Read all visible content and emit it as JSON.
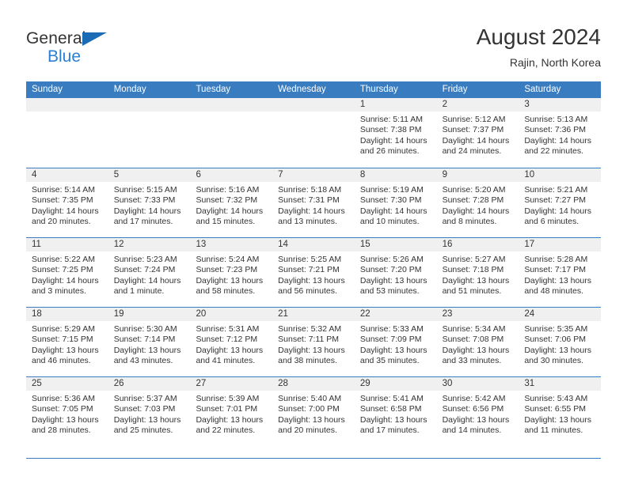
{
  "brand": {
    "line1": "General",
    "line2": "Blue",
    "logo_icon": "blue-triangle-logo-icon"
  },
  "header": {
    "title": "August 2024",
    "subtitle": "Rajin, North Korea"
  },
  "colors": {
    "header_blue": "#3a7cc0",
    "brand_blue": "#2a7fd4",
    "logo_blue": "#1b6cb5",
    "day_number_bg": "#f0f0f0",
    "text": "#333333"
  },
  "calendar": {
    "weekdays": [
      "Sunday",
      "Monday",
      "Tuesday",
      "Wednesday",
      "Thursday",
      "Friday",
      "Saturday"
    ],
    "weeks": [
      [
        {
          "day": "",
          "sunrise": "",
          "sunset": "",
          "daylight1": "",
          "daylight2": ""
        },
        {
          "day": "",
          "sunrise": "",
          "sunset": "",
          "daylight1": "",
          "daylight2": ""
        },
        {
          "day": "",
          "sunrise": "",
          "sunset": "",
          "daylight1": "",
          "daylight2": ""
        },
        {
          "day": "",
          "sunrise": "",
          "sunset": "",
          "daylight1": "",
          "daylight2": ""
        },
        {
          "day": "1",
          "sunrise": "Sunrise: 5:11 AM",
          "sunset": "Sunset: 7:38 PM",
          "daylight1": "Daylight: 14 hours",
          "daylight2": "and 26 minutes."
        },
        {
          "day": "2",
          "sunrise": "Sunrise: 5:12 AM",
          "sunset": "Sunset: 7:37 PM",
          "daylight1": "Daylight: 14 hours",
          "daylight2": "and 24 minutes."
        },
        {
          "day": "3",
          "sunrise": "Sunrise: 5:13 AM",
          "sunset": "Sunset: 7:36 PM",
          "daylight1": "Daylight: 14 hours",
          "daylight2": "and 22 minutes."
        }
      ],
      [
        {
          "day": "4",
          "sunrise": "Sunrise: 5:14 AM",
          "sunset": "Sunset: 7:35 PM",
          "daylight1": "Daylight: 14 hours",
          "daylight2": "and 20 minutes."
        },
        {
          "day": "5",
          "sunrise": "Sunrise: 5:15 AM",
          "sunset": "Sunset: 7:33 PM",
          "daylight1": "Daylight: 14 hours",
          "daylight2": "and 17 minutes."
        },
        {
          "day": "6",
          "sunrise": "Sunrise: 5:16 AM",
          "sunset": "Sunset: 7:32 PM",
          "daylight1": "Daylight: 14 hours",
          "daylight2": "and 15 minutes."
        },
        {
          "day": "7",
          "sunrise": "Sunrise: 5:18 AM",
          "sunset": "Sunset: 7:31 PM",
          "daylight1": "Daylight: 14 hours",
          "daylight2": "and 13 minutes."
        },
        {
          "day": "8",
          "sunrise": "Sunrise: 5:19 AM",
          "sunset": "Sunset: 7:30 PM",
          "daylight1": "Daylight: 14 hours",
          "daylight2": "and 10 minutes."
        },
        {
          "day": "9",
          "sunrise": "Sunrise: 5:20 AM",
          "sunset": "Sunset: 7:28 PM",
          "daylight1": "Daylight: 14 hours",
          "daylight2": "and 8 minutes."
        },
        {
          "day": "10",
          "sunrise": "Sunrise: 5:21 AM",
          "sunset": "Sunset: 7:27 PM",
          "daylight1": "Daylight: 14 hours",
          "daylight2": "and 6 minutes."
        }
      ],
      [
        {
          "day": "11",
          "sunrise": "Sunrise: 5:22 AM",
          "sunset": "Sunset: 7:25 PM",
          "daylight1": "Daylight: 14 hours",
          "daylight2": "and 3 minutes."
        },
        {
          "day": "12",
          "sunrise": "Sunrise: 5:23 AM",
          "sunset": "Sunset: 7:24 PM",
          "daylight1": "Daylight: 14 hours",
          "daylight2": "and 1 minute."
        },
        {
          "day": "13",
          "sunrise": "Sunrise: 5:24 AM",
          "sunset": "Sunset: 7:23 PM",
          "daylight1": "Daylight: 13 hours",
          "daylight2": "and 58 minutes."
        },
        {
          "day": "14",
          "sunrise": "Sunrise: 5:25 AM",
          "sunset": "Sunset: 7:21 PM",
          "daylight1": "Daylight: 13 hours",
          "daylight2": "and 56 minutes."
        },
        {
          "day": "15",
          "sunrise": "Sunrise: 5:26 AM",
          "sunset": "Sunset: 7:20 PM",
          "daylight1": "Daylight: 13 hours",
          "daylight2": "and 53 minutes."
        },
        {
          "day": "16",
          "sunrise": "Sunrise: 5:27 AM",
          "sunset": "Sunset: 7:18 PM",
          "daylight1": "Daylight: 13 hours",
          "daylight2": "and 51 minutes."
        },
        {
          "day": "17",
          "sunrise": "Sunrise: 5:28 AM",
          "sunset": "Sunset: 7:17 PM",
          "daylight1": "Daylight: 13 hours",
          "daylight2": "and 48 minutes."
        }
      ],
      [
        {
          "day": "18",
          "sunrise": "Sunrise: 5:29 AM",
          "sunset": "Sunset: 7:15 PM",
          "daylight1": "Daylight: 13 hours",
          "daylight2": "and 46 minutes."
        },
        {
          "day": "19",
          "sunrise": "Sunrise: 5:30 AM",
          "sunset": "Sunset: 7:14 PM",
          "daylight1": "Daylight: 13 hours",
          "daylight2": "and 43 minutes."
        },
        {
          "day": "20",
          "sunrise": "Sunrise: 5:31 AM",
          "sunset": "Sunset: 7:12 PM",
          "daylight1": "Daylight: 13 hours",
          "daylight2": "and 41 minutes."
        },
        {
          "day": "21",
          "sunrise": "Sunrise: 5:32 AM",
          "sunset": "Sunset: 7:11 PM",
          "daylight1": "Daylight: 13 hours",
          "daylight2": "and 38 minutes."
        },
        {
          "day": "22",
          "sunrise": "Sunrise: 5:33 AM",
          "sunset": "Sunset: 7:09 PM",
          "daylight1": "Daylight: 13 hours",
          "daylight2": "and 35 minutes."
        },
        {
          "day": "23",
          "sunrise": "Sunrise: 5:34 AM",
          "sunset": "Sunset: 7:08 PM",
          "daylight1": "Daylight: 13 hours",
          "daylight2": "and 33 minutes."
        },
        {
          "day": "24",
          "sunrise": "Sunrise: 5:35 AM",
          "sunset": "Sunset: 7:06 PM",
          "daylight1": "Daylight: 13 hours",
          "daylight2": "and 30 minutes."
        }
      ],
      [
        {
          "day": "25",
          "sunrise": "Sunrise: 5:36 AM",
          "sunset": "Sunset: 7:05 PM",
          "daylight1": "Daylight: 13 hours",
          "daylight2": "and 28 minutes."
        },
        {
          "day": "26",
          "sunrise": "Sunrise: 5:37 AM",
          "sunset": "Sunset: 7:03 PM",
          "daylight1": "Daylight: 13 hours",
          "daylight2": "and 25 minutes."
        },
        {
          "day": "27",
          "sunrise": "Sunrise: 5:39 AM",
          "sunset": "Sunset: 7:01 PM",
          "daylight1": "Daylight: 13 hours",
          "daylight2": "and 22 minutes."
        },
        {
          "day": "28",
          "sunrise": "Sunrise: 5:40 AM",
          "sunset": "Sunset: 7:00 PM",
          "daylight1": "Daylight: 13 hours",
          "daylight2": "and 20 minutes."
        },
        {
          "day": "29",
          "sunrise": "Sunrise: 5:41 AM",
          "sunset": "Sunset: 6:58 PM",
          "daylight1": "Daylight: 13 hours",
          "daylight2": "and 17 minutes."
        },
        {
          "day": "30",
          "sunrise": "Sunrise: 5:42 AM",
          "sunset": "Sunset: 6:56 PM",
          "daylight1": "Daylight: 13 hours",
          "daylight2": "and 14 minutes."
        },
        {
          "day": "31",
          "sunrise": "Sunrise: 5:43 AM",
          "sunset": "Sunset: 6:55 PM",
          "daylight1": "Daylight: 13 hours",
          "daylight2": "and 11 minutes."
        }
      ]
    ]
  }
}
